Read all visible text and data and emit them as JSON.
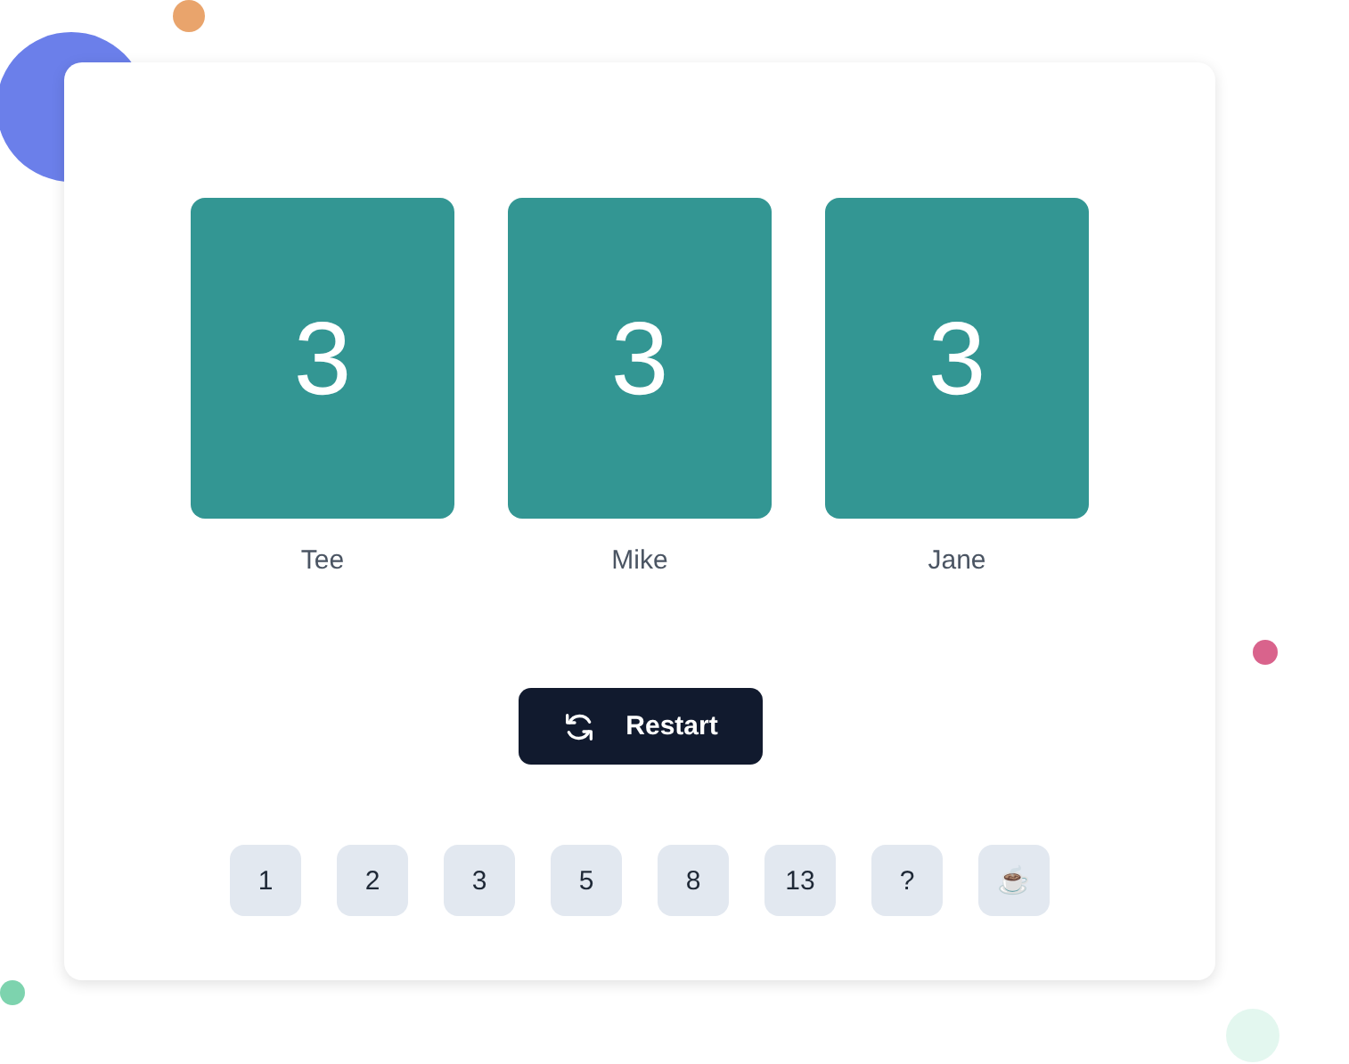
{
  "players": [
    {
      "name": "Tee",
      "vote": "3"
    },
    {
      "name": "Mike",
      "vote": "3"
    },
    {
      "name": "Jane",
      "vote": "3"
    }
  ],
  "restart_button": {
    "label": "Restart"
  },
  "vote_options": [
    "1",
    "2",
    "3",
    "5",
    "8",
    "13",
    "?",
    "☕"
  ]
}
